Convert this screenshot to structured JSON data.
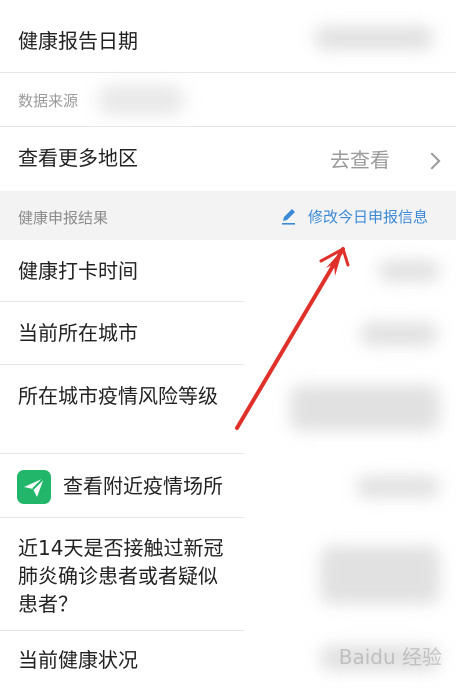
{
  "rows": {
    "report_date": "健康报告日期",
    "data_source": "数据来源",
    "view_more_regions": "查看更多地区",
    "go_view": "去查看",
    "section_title": "健康申报结果",
    "edit_today": "修改今日申报信息",
    "checkin_time": "健康打卡时间",
    "current_city": "当前所在城市",
    "city_risk_level": "所在城市疫情风险等级",
    "nearby_places": "查看附近疫情场所",
    "contact_question": "近14天是否接触过新冠肺炎确诊患者或者疑似患者？",
    "current_health": "当前健康状况"
  },
  "watermark": "Baidu 经验",
  "icons": {
    "edit": "pencil-icon",
    "nearby": "paper-plane-icon",
    "chevron": "chevron-right-icon"
  },
  "colors": {
    "link": "#3c8ad6",
    "arrow": "#e0302a",
    "green": "#21b66a"
  }
}
